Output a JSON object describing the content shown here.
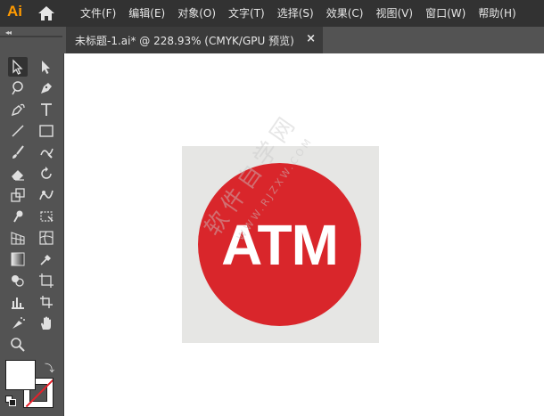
{
  "app": {
    "logo": "Ai"
  },
  "menu": [
    "文件(F)",
    "编辑(E)",
    "对象(O)",
    "文字(T)",
    "选择(S)",
    "效果(C)",
    "视图(V)",
    "窗口(W)",
    "帮助(H)"
  ],
  "panel": {
    "collapse_label": "◂◂"
  },
  "document_tab": {
    "label": "未标题-1.ai* @ 228.93% (CMYK/GPU 预览)",
    "close": "×"
  },
  "artwork": {
    "text": "ATM",
    "background_color": "#e6e6e4",
    "circle_color": "#d9262b",
    "text_color": "#ffffff"
  },
  "watermark": {
    "text": "软件自学网",
    "url": "WWW.RJZXW.COM"
  },
  "colors": {
    "menubar": "#323232",
    "toolbar": "#535353",
    "logo": "#ff9a00",
    "canvas": "#ffffff"
  },
  "tools": [
    "selection-tool",
    "direct-selection-tool",
    "magic-wand-tool",
    "pen-tool",
    "curvature-tool",
    "type-tool",
    "line-tool",
    "rectangle-tool",
    "paintbrush-tool",
    "shaper-tool",
    "eraser-tool",
    "rotate-tool",
    "scale-tool",
    "warp-tool",
    "puppet-warp-tool",
    "free-transform-tool",
    "perspective-grid-tool",
    "mesh-tool",
    "gradient-tool",
    "eyedropper-tool",
    "shape-builder-tool",
    "artboard-tool",
    "graph-tool",
    "slice-tool",
    "symbol-sprayer-tool",
    "hand-tool",
    "zoom-tool"
  ]
}
